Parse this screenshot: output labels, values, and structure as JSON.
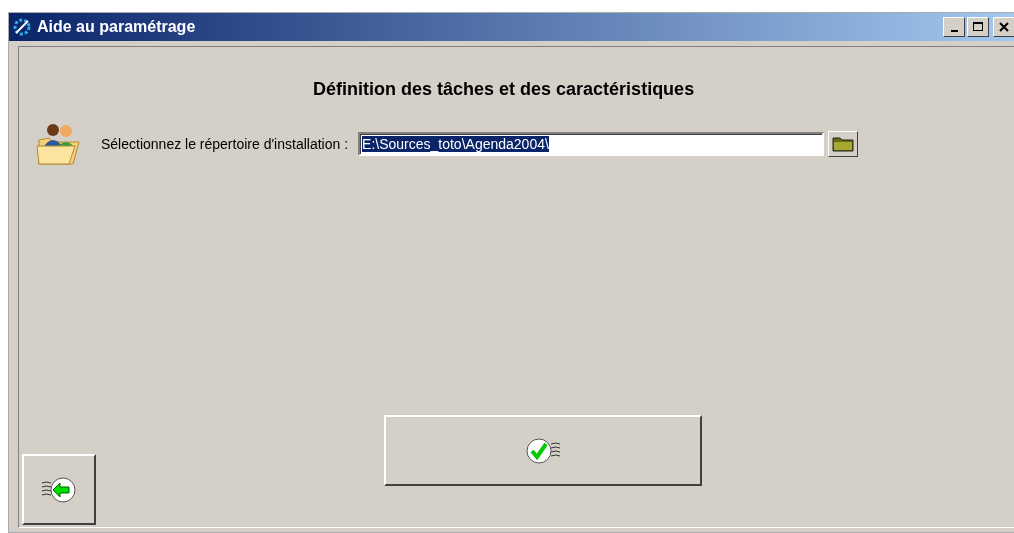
{
  "window": {
    "title": "Aide au paramétrage"
  },
  "heading": "Définition des tâches et des caractéristiques",
  "install_dir": {
    "label": "Sélectionnez le répertoire d'installation :",
    "value": "E:\\Sources_toto\\Agenda2004\\",
    "selected": true
  }
}
